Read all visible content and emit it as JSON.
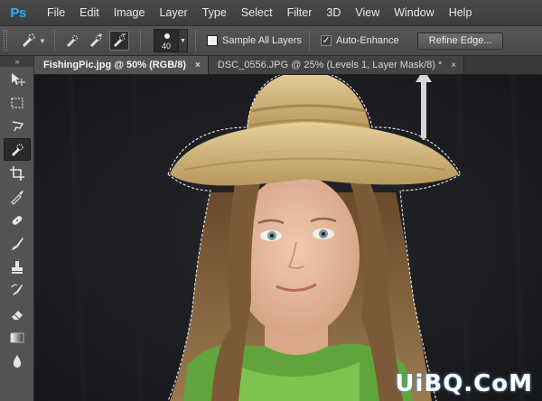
{
  "app": {
    "logo": "Ps",
    "menu": [
      "File",
      "Edit",
      "Image",
      "Layer",
      "Type",
      "Select",
      "Filter",
      "3D",
      "View",
      "Window",
      "Help"
    ]
  },
  "options_bar": {
    "brush_size": "40",
    "sample_all_layers": {
      "label": "Sample All Layers",
      "checked": false
    },
    "auto_enhance": {
      "label": "Auto-Enhance",
      "checked": true
    },
    "refine_edge_label": "Refine Edge..."
  },
  "tabs": [
    {
      "label": "FishingPic.jpg @ 50% (RGB/8)",
      "active": true,
      "close": "×"
    },
    {
      "label": "DSC_0556.JPG @ 25% (Levels 1, Layer Mask/8) *",
      "active": false,
      "close": "×"
    }
  ],
  "toolbar": {
    "head": "»",
    "tools": [
      "move-icon",
      "marquee-icon",
      "lasso-icon",
      "quick-selection-icon",
      "crop-icon",
      "eyedropper-icon",
      "healing-icon",
      "brush-icon",
      "stamp-icon",
      "history-brush-icon",
      "eraser-icon",
      "gradient-icon",
      "blur-icon"
    ],
    "active_tool": "quick-selection-icon"
  },
  "watermark": "UiBQ.CoM",
  "colors": {
    "accent": "#31a8ff",
    "background": "#1c1d20",
    "panel": "#535353"
  }
}
